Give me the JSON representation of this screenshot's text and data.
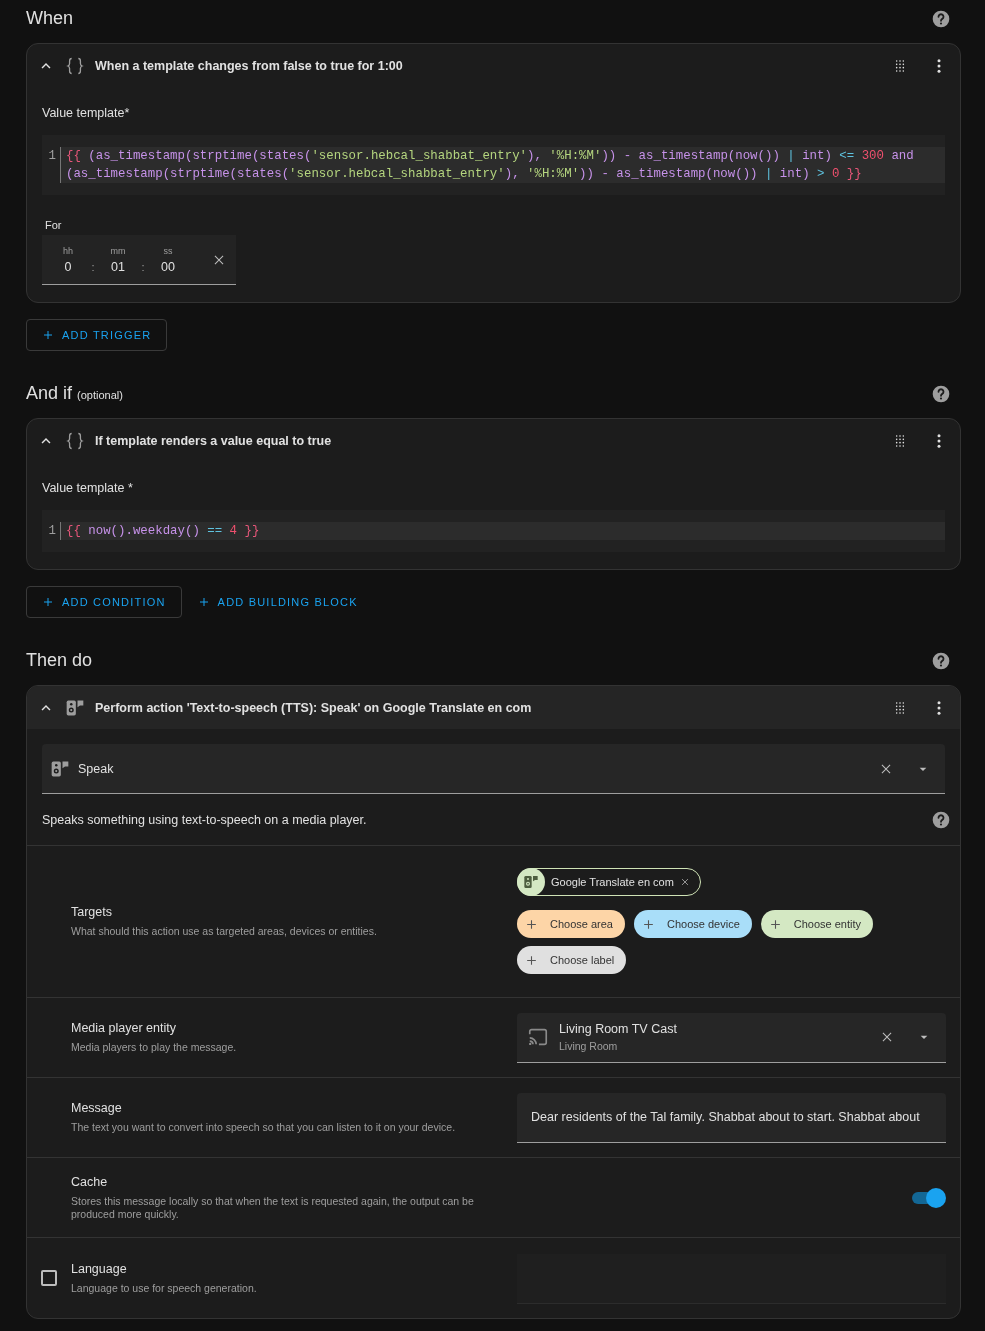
{
  "when": {
    "title": "When",
    "cards": [
      {
        "kind": "template",
        "expanded": true,
        "title": "When a template changes from false to true for 1:00",
        "field_label": "Value template*",
        "code": [
          {
            "number": "1",
            "rows": [
              {
                "tokens": [
                  {
                    "kind": "brace",
                    "text": "{{"
                  },
                  {
                    "kind": "func",
                    "text": " (as_timestamp(strptime(states("
                  },
                  {
                    "kind": "string",
                    "text": "'sensor.hebcal_shabbat_entry'"
                  },
                  {
                    "kind": "func",
                    "text": "), "
                  },
                  {
                    "kind": "string",
                    "text": "'%H:%M'"
                  },
                  {
                    "kind": "func",
                    "text": ")) - as_timestamp(now()) "
                  },
                  {
                    "kind": "op",
                    "text": "|"
                  },
                  {
                    "kind": "func",
                    "text": " int) "
                  },
                  {
                    "kind": "op",
                    "text": "<= "
                  },
                  {
                    "kind": "number",
                    "text": "300"
                  },
                  {
                    "kind": "func",
                    "text": " and"
                  }
                ]
              },
              {
                "tokens": [
                  {
                    "kind": "func",
                    "text": "(as_timestamp(strptime(states("
                  },
                  {
                    "kind": "string",
                    "text": "'sensor.hebcal_shabbat_entry'"
                  },
                  {
                    "kind": "func",
                    "text": "), "
                  },
                  {
                    "kind": "string",
                    "text": "'%H:%M'"
                  },
                  {
                    "kind": "func",
                    "text": ")) - as_timestamp(now()) "
                  },
                  {
                    "kind": "op",
                    "text": "|"
                  },
                  {
                    "kind": "func",
                    "text": " int) "
                  },
                  {
                    "kind": "op",
                    "text": "> "
                  },
                  {
                    "kind": "number",
                    "text": "0 "
                  },
                  {
                    "kind": "brace",
                    "text": "}}"
                  }
                ]
              }
            ]
          }
        ],
        "duration": {
          "label": "For",
          "separator": ":",
          "units": [
            {
              "label": "hh",
              "value": "0"
            },
            {
              "label": "mm",
              "value": "01"
            },
            {
              "label": "ss",
              "value": "00"
            }
          ]
        }
      }
    ],
    "buttons": [
      {
        "label": "ADD TRIGGER",
        "outlined": true
      }
    ]
  },
  "and_if": {
    "title": "And if",
    "note": "(optional)",
    "cards": [
      {
        "kind": "template",
        "expanded": true,
        "title": "If template renders a value equal to true",
        "field_label": "Value template *",
        "code": [
          {
            "number": "1",
            "rows": [
              {
                "tokens": [
                  {
                    "kind": "brace",
                    "text": "{{"
                  },
                  {
                    "kind": "func",
                    "text": " now().weekday() "
                  },
                  {
                    "kind": "op",
                    "text": "== "
                  },
                  {
                    "kind": "number",
                    "text": "4 "
                  },
                  {
                    "kind": "brace",
                    "text": "}}"
                  }
                ]
              }
            ]
          }
        ]
      }
    ],
    "buttons": [
      {
        "label": "ADD CONDITION",
        "outlined": true
      },
      {
        "label": "ADD BUILDING BLOCK",
        "outlined": false
      }
    ]
  },
  "then_do": {
    "title": "Then do",
    "cards": [
      {
        "kind": "action",
        "expanded": true,
        "title": "Perform action 'Text-to-speech (TTS): Speak' on Google Translate en com",
        "action_value": "Speak",
        "description": "Speaks something using text-to-speech on a media player.",
        "params": [
          {
            "kind": "targets",
            "label": "Targets",
            "description": "What should this action use as targeted areas, devices or entities.",
            "chips": [
              {
                "label": "Google Translate en com"
              }
            ],
            "pickers": [
              {
                "label": "Choose area",
                "color": "#fdd5a7"
              },
              {
                "label": "Choose device",
                "color": "#a9def9"
              },
              {
                "label": "Choose entity",
                "color": "#d4e8c3"
              },
              {
                "label": "Choose label",
                "color": "#e0e0e0"
              }
            ]
          },
          {
            "kind": "entity",
            "label": "Media player entity",
            "description": "Media players to play the message.",
            "value": "Living Room TV Cast",
            "secondary": "Living Room"
          },
          {
            "kind": "text",
            "label": "Message",
            "description": "The text you want to convert into speech so that you can listen to it on your device.",
            "value": "Dear residents of the Tal family. Shabbat about to start. Shabbat about"
          },
          {
            "kind": "toggle",
            "label": "Cache",
            "description": "Stores this message locally so that when the text is requested again, the output can be produced more quickly.",
            "on": true
          },
          {
            "kind": "select",
            "label": "Language",
            "description": "Language to use for speech generation.",
            "checked": false
          }
        ]
      }
    ]
  }
}
